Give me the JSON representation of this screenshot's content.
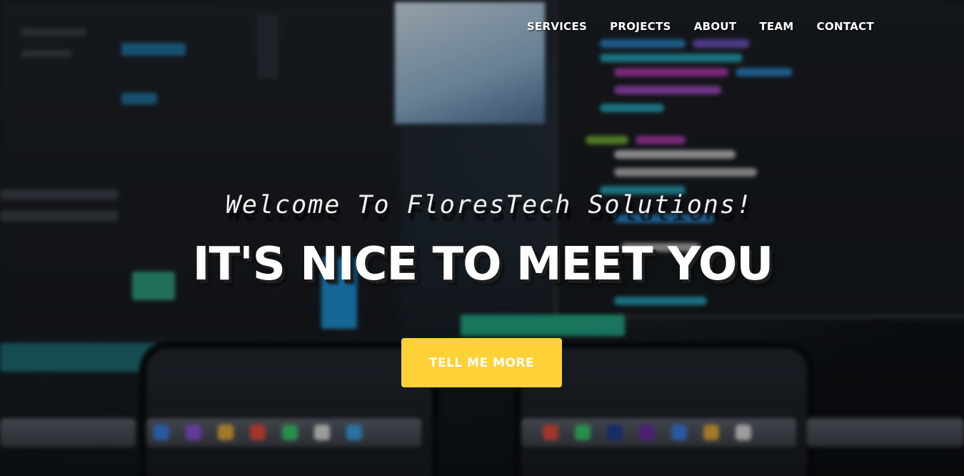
{
  "nav": {
    "items": [
      {
        "label": "SERVICES"
      },
      {
        "label": "PROJECTS"
      },
      {
        "label": "ABOUT"
      },
      {
        "label": "TEAM"
      },
      {
        "label": "CONTACT"
      }
    ]
  },
  "hero": {
    "lead": "Welcome To FloresTech Solutions!",
    "heading": "IT'S NICE TO MEET YOU",
    "cta_label": "TELL ME MORE",
    "accent_color": "#fed136",
    "text_color": "#ffffff",
    "background_image": "blurred photo of computer monitors with code through eyeglasses"
  }
}
